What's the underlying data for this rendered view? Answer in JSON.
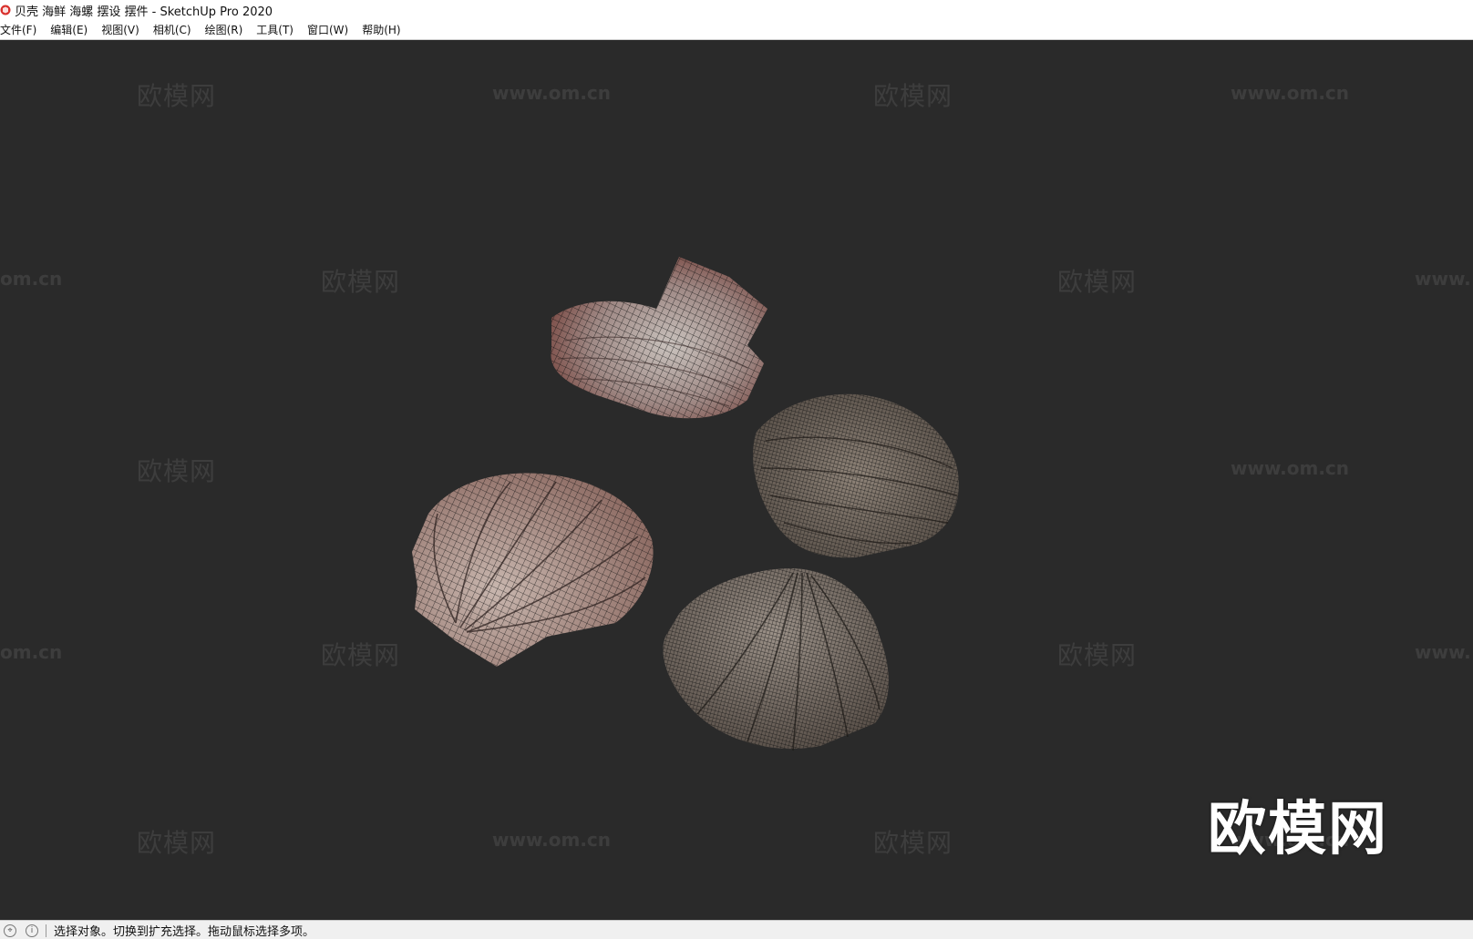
{
  "window": {
    "title": "贝壳 海鲜 海螺 摆设 摆件 - SketchUp Pro 2020"
  },
  "menu": [
    "文件(F)",
    "编辑(E)",
    "视图(V)",
    "相机(C)",
    "绘图(R)",
    "工具(T)",
    "窗口(W)",
    "帮助(H)"
  ],
  "watermark": {
    "cn": "欧模网",
    "url": "www.om.cn",
    "url_partial": "om.cn",
    "url_partial_right": "www.",
    "logo": "欧模网"
  },
  "status": {
    "hint": "选择对象。切换到扩充选择。拖动鼠标选择多项。"
  },
  "colors": {
    "viewport": "#2a2a2a",
    "titlebar": "#ffffff",
    "statusbar": "#f0f0f0"
  },
  "icons": {
    "app": "sketchup-logo-icon",
    "status_geo": "geolocation-icon",
    "status_info": "info-icon"
  }
}
